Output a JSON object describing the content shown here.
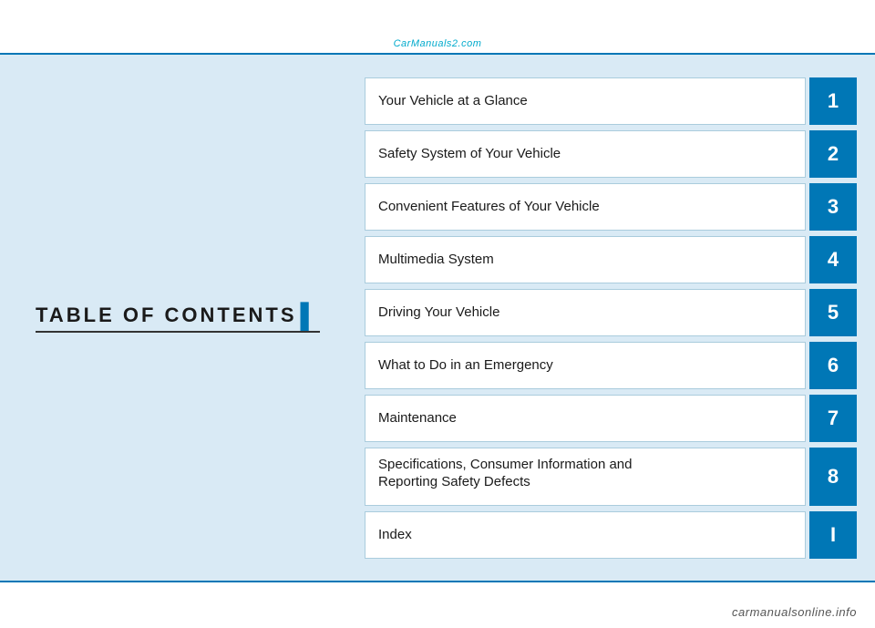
{
  "watermark": {
    "text": "CarManuals2.com"
  },
  "left_panel": {
    "title": "TABLE OF CONTENTS",
    "title_marker": "▌"
  },
  "toc": {
    "items": [
      {
        "label": "Your Vehicle at a Glance",
        "number": "1"
      },
      {
        "label": "Safety System of Your Vehicle",
        "number": "2"
      },
      {
        "label": "Convenient Features of Your Vehicle",
        "number": "3"
      },
      {
        "label": "Multimedia System",
        "number": "4"
      },
      {
        "label": "Driving Your Vehicle",
        "number": "5"
      },
      {
        "label": "What to Do in an Emergency",
        "number": "6"
      },
      {
        "label": "Maintenance",
        "number": "7"
      },
      {
        "label": "Specifications, Consumer Information and\nReporting Safety Defects",
        "number": "8"
      },
      {
        "label": "Index",
        "number": "I"
      }
    ]
  },
  "bottom_logo": {
    "text": "carmanualsonline.info"
  },
  "colors": {
    "accent_blue": "#0077b6",
    "light_bg": "#d9eaf5",
    "border": "#aaccdd",
    "text_dark": "#1a1a1a",
    "watermark": "#00aacc"
  }
}
